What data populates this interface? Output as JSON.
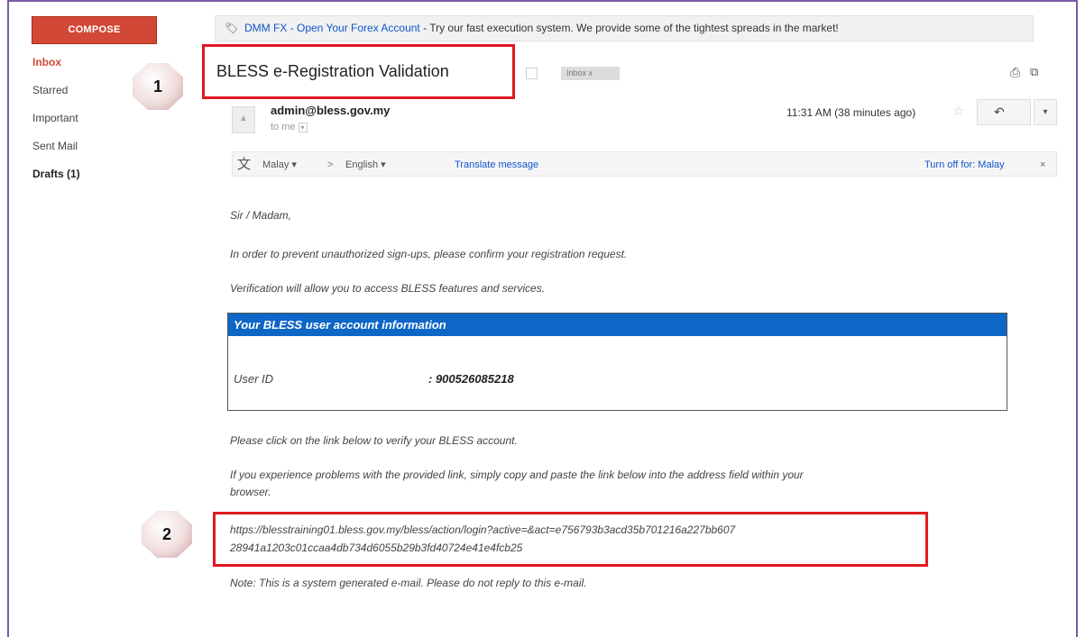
{
  "sidebar": {
    "compose_label": "COMPOSE",
    "items": [
      {
        "label": "Inbox"
      },
      {
        "label": "Starred"
      },
      {
        "label": "Important"
      },
      {
        "label": "Sent Mail"
      },
      {
        "label": "Drafts (1)"
      }
    ]
  },
  "ad": {
    "link_text": "DMM FX - Open Your Forex Account",
    "text": " - Try our fast execution system. We provide some of the tightest spreads in the market!"
  },
  "message": {
    "subject": "BLESS e-Registration Validation",
    "label_chip": "Inbox  x",
    "sender": "admin@bless.gov.my",
    "to": "to me",
    "time": "11:31 AM (38 minutes ago)"
  },
  "translate": {
    "from_lang": "Malay ▾",
    "arrow": ">",
    "to_lang": "English ▾",
    "translate_link": "Translate message",
    "turn_off": "Turn off for: Malay",
    "close": "×"
  },
  "body": {
    "greeting": "Sir / Madam,",
    "para1": "In order to prevent unauthorized sign-ups, please confirm your registration request.",
    "para2": "Verification will allow you to access BLESS features and services.",
    "box_title": "Your BLESS user account information",
    "user_id_label": "User ID",
    "user_id_value": ": 900526085218",
    "para3": "Please click on the link below to verify your BLESS account.",
    "para4_line1": "If you experience problems with the provided link, simply copy and paste the link below into the address field within your",
    "para4_line2": "browser.",
    "link_line1": "https://blesstraining01.bless.gov.my/bless/action/login?active=&act=e756793b3acd35b701216a227bb607",
    "link_line2": "28941a1203c01ccaa4db734d6055b29b3fd40724e41e4fcb25",
    "note": "Note: This is a system generated e-mail. Please do not reply to this e-mail."
  },
  "callouts": [
    {
      "number": "1"
    },
    {
      "number": "2"
    }
  ],
  "colors": {
    "compose": "#d14836",
    "link": "#1155cc",
    "box_header": "#0e66c7",
    "callout_border": "#e0191f"
  }
}
